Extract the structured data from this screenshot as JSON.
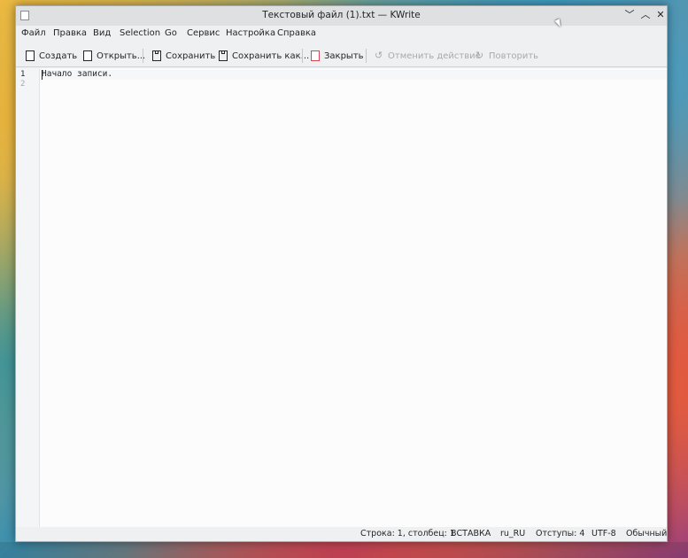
{
  "window": {
    "title": "Текстовый файл (1).txt — KWrite",
    "controls": {
      "minimize": "﹀",
      "maximize": "︿",
      "close": "✕"
    }
  },
  "menu": [
    "Файл",
    "Правка",
    "Вид",
    "Selection",
    "Go",
    "Сервис",
    "Настройка",
    "Справка"
  ],
  "toolbar": {
    "new_label": "Создать",
    "open_label": "Открыть...",
    "save_label": "Сохранить",
    "save_as_label": "Сохранить как...",
    "close_label": "Закрыть",
    "undo_label": "Отменить действие",
    "redo_label": "Повторить",
    "undo_glyph": "↺",
    "redo_glyph": "↻"
  },
  "editor": {
    "line_numbers": [
      "1",
      "2"
    ],
    "lines": [
      "Начало записи."
    ]
  },
  "status": {
    "position": "Строка: 1, столбец: 1",
    "mode": "ВСТАВКА",
    "language": "ru_RU",
    "indent": "Отступы: 4",
    "encoding": "UTF-8",
    "highlight": "Обычный"
  },
  "colors": {
    "close_icon_accent": "#da4453"
  }
}
